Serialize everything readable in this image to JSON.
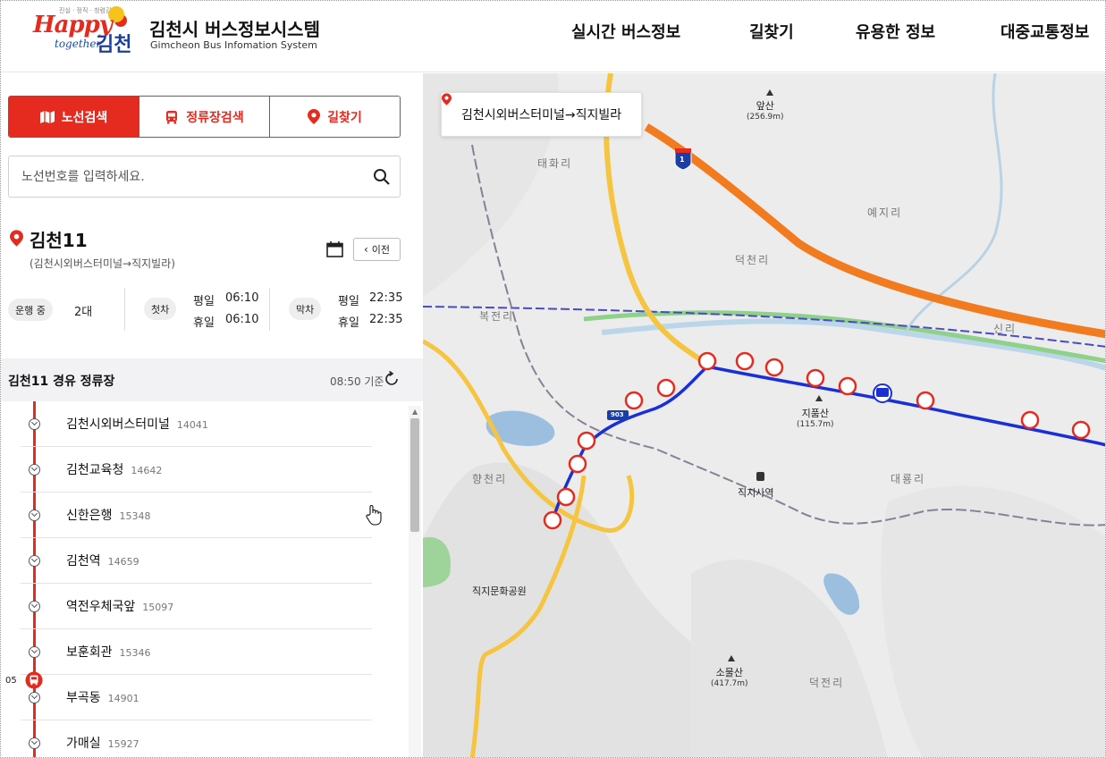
{
  "header": {
    "logo_slogan": "진실 · 정직 · 청렴김천",
    "logo_word": "Happy",
    "logo_together": "together",
    "logo_city": "김천",
    "title": "김천시 버스정보시스템",
    "subtitle": "Gimcheon Bus Infomation System",
    "nav": [
      "실시간 버스정보",
      "길찾기",
      "유용한 정보",
      "대중교통정보"
    ]
  },
  "tabs": [
    {
      "label": "노선검색",
      "icon": "map-icon",
      "active": true
    },
    {
      "label": "정류장검색",
      "icon": "bus-icon",
      "active": false
    },
    {
      "label": "길찾기",
      "icon": "pin-icon",
      "active": false
    }
  ],
  "search": {
    "placeholder": "노선번호를 입력하세요.",
    "value": ""
  },
  "route": {
    "name": "김천11",
    "direction": "(김천시외버스터미널→직지빌라)",
    "prev_label": "이전",
    "status_label": "운행 중",
    "vehicle_count": "2대",
    "first_label": "첫차",
    "last_label": "막차",
    "weekday_label": "평일",
    "holiday_label": "휴일",
    "first_weekday": "06:10",
    "first_holiday": "06:10",
    "last_weekday": "22:35",
    "last_holiday": "22:35"
  },
  "stops_header": {
    "title": "김천11 경유 정류장",
    "time": "08:50 기준"
  },
  "stops": [
    {
      "name": "김천시외버스터미널",
      "code": "14041"
    },
    {
      "name": "김천교육청",
      "code": "14642"
    },
    {
      "name": "신한은행",
      "code": "15348"
    },
    {
      "name": "김천역",
      "code": "14659"
    },
    {
      "name": "역전우체국앞",
      "code": "15097"
    },
    {
      "name": "보훈회관",
      "code": "15346"
    },
    {
      "name": "부곡동",
      "code": "14901"
    },
    {
      "name": "가매실",
      "code": "15927"
    }
  ],
  "bus_marker_label": "05",
  "map": {
    "route_box": "김천시외버스터미널→직지빌라",
    "highway_shield": "1",
    "road_shield": "903",
    "places": [
      "태화리",
      "예지리",
      "덕천리",
      "복전리",
      "신리",
      "향천리",
      "대룡리",
      "덕전리"
    ],
    "station_label": "직지사역",
    "park_label": "직지문화공원",
    "peaks": [
      {
        "name": "앞산",
        "height": "(256.9m)"
      },
      {
        "name": "지품산",
        "height": "(115.7m)"
      },
      {
        "name": "소물산",
        "height": "(417.7m)"
      }
    ],
    "colors": {
      "accent": "#e52b1f",
      "route": "#1a2fd6",
      "highway": "#f27a1f",
      "road": "#f5c542"
    }
  }
}
